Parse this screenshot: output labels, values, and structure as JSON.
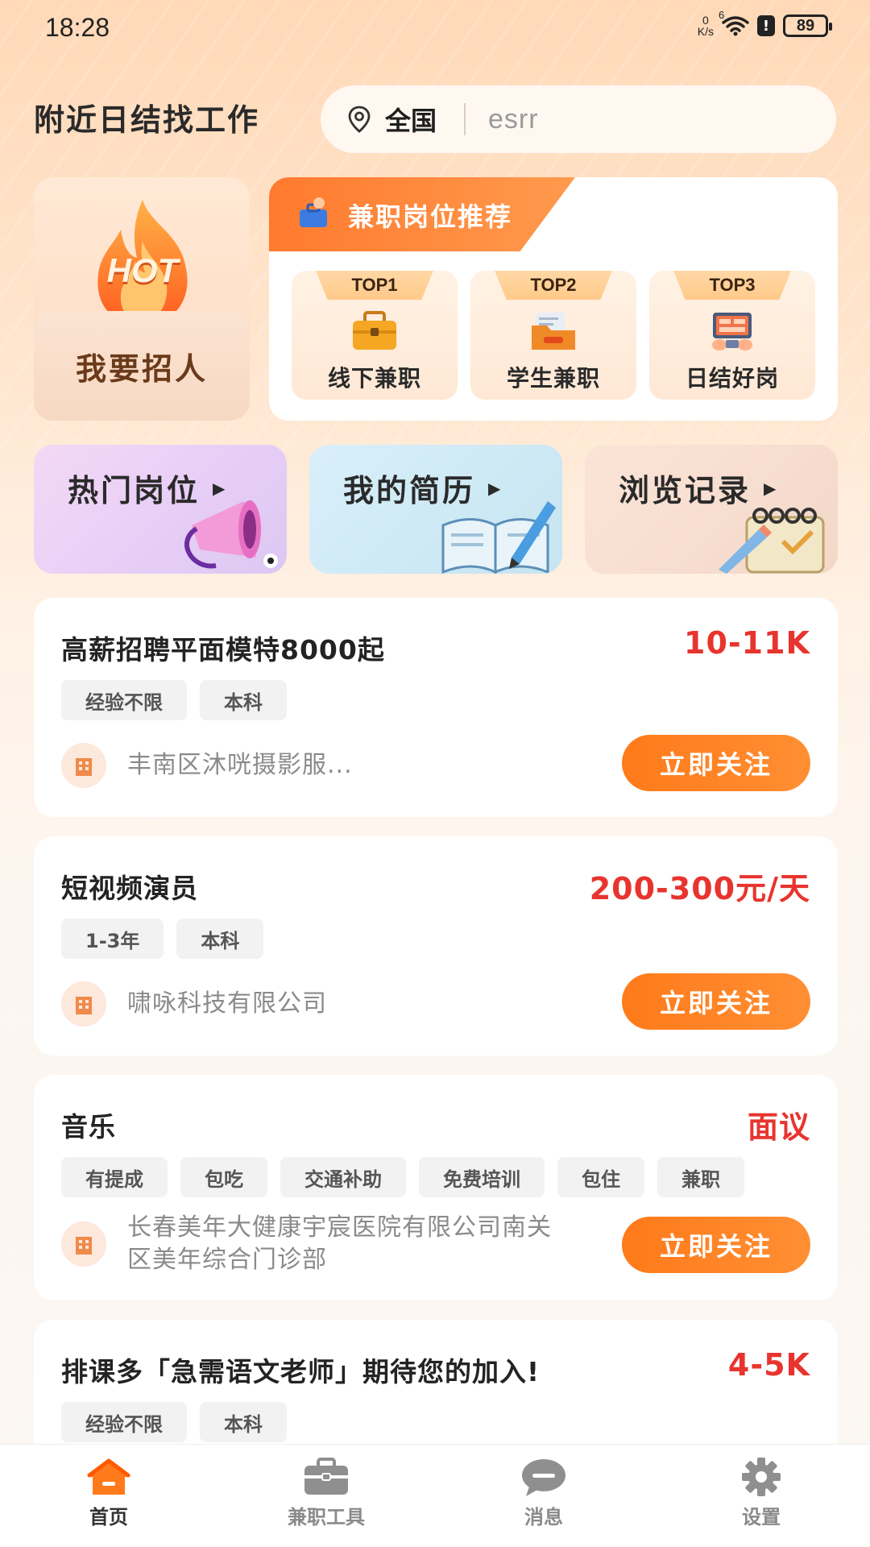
{
  "status_bar": {
    "time": "18:28",
    "net_speed_top": "0",
    "net_speed_unit": "K/s",
    "wifi_sup": "6",
    "battery": "89"
  },
  "header": {
    "title": "附近日结找工作",
    "location": "全国",
    "search_value": "esrr"
  },
  "recruit": {
    "hot_badge": "HOT",
    "label": "我要招人"
  },
  "recommend": {
    "title": "兼职岗位推荐",
    "items": [
      {
        "rank": "TOP1",
        "label": "线下兼职"
      },
      {
        "rank": "TOP2",
        "label": "学生兼职"
      },
      {
        "rank": "TOP3",
        "label": "日结好岗"
      }
    ]
  },
  "quick_links": [
    {
      "label": "热门岗位"
    },
    {
      "label": "我的简历"
    },
    {
      "label": "浏览记录"
    }
  ],
  "jobs": [
    {
      "title": "高薪招聘平面模特8000起",
      "salary": "10-11K",
      "tags": [
        "经验不限",
        "本科"
      ],
      "company": "丰南区沐咣摄影服...",
      "follow": "立即关注"
    },
    {
      "title": "短视频演员",
      "salary": "200-300元/天",
      "tags": [
        "1-3年",
        "本科"
      ],
      "company": "啸咏科技有限公司",
      "follow": "立即关注"
    },
    {
      "title": "音乐",
      "salary": "面议",
      "tags": [
        "有提成",
        "包吃",
        "交通补助",
        "免费培训",
        "包住",
        "兼职"
      ],
      "company_line1": "长春美年大健康宇宸医院有限公司南关",
      "company_line2": "区美年综合门诊部",
      "follow": "立即关注"
    },
    {
      "title": "排课多「急需语文老师」期待您的加入!",
      "salary": "4-5K",
      "tags": [
        "经验不限",
        "本科"
      ]
    }
  ],
  "bottom_nav": {
    "items": [
      {
        "label": "首页",
        "icon": "home-icon",
        "active": true
      },
      {
        "label": "兼职工具",
        "icon": "briefcase-icon",
        "active": false
      },
      {
        "label": "消息",
        "icon": "chat-icon",
        "active": false
      },
      {
        "label": "设置",
        "icon": "gear-icon",
        "active": false
      }
    ]
  },
  "colors": {
    "accent": "#ff7a1a",
    "salary": "#e8342e"
  }
}
